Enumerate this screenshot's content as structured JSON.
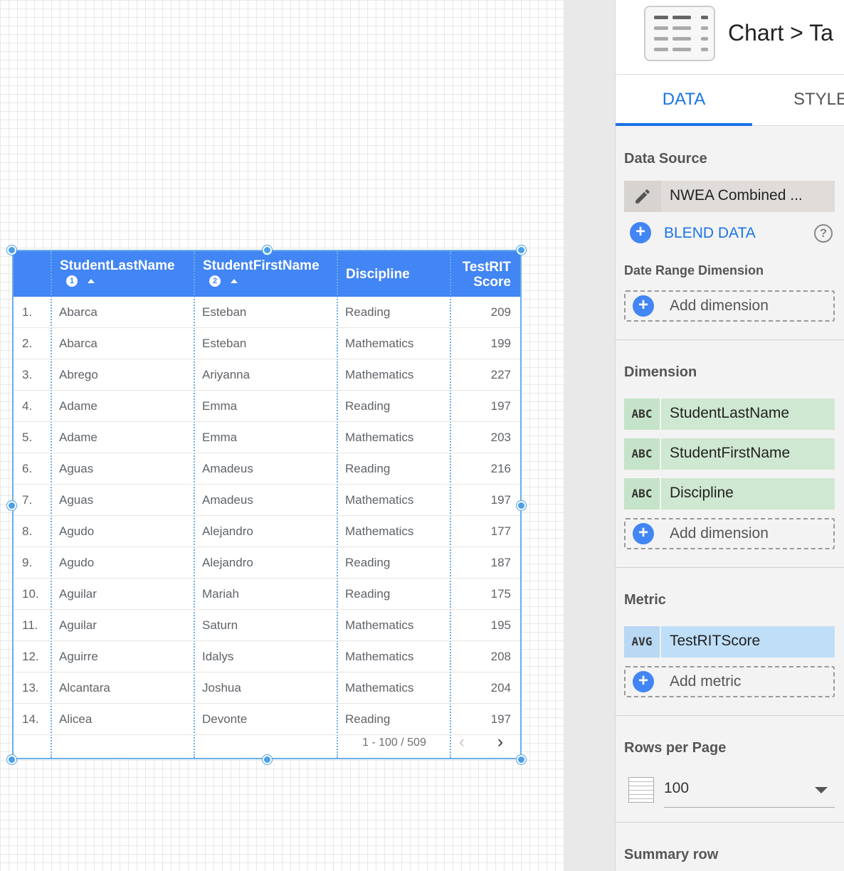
{
  "table": {
    "headers": {
      "last": "StudentLastName",
      "first": "StudentFirstName",
      "discipline": "Discipline",
      "score_line1": "TestRIT",
      "score_line2": "Score",
      "sort1": "1",
      "sort2": "2"
    },
    "rows": [
      [
        "1.",
        "Abarca",
        "Esteban",
        "Reading",
        "209"
      ],
      [
        "2.",
        "Abarca",
        "Esteban",
        "Mathematics",
        "199"
      ],
      [
        "3.",
        "Abrego",
        "Ariyanna",
        "Mathematics",
        "227"
      ],
      [
        "4.",
        "Adame",
        "Emma",
        "Reading",
        "197"
      ],
      [
        "5.",
        "Adame",
        "Emma",
        "Mathematics",
        "203"
      ],
      [
        "6.",
        "Aguas",
        "Amadeus",
        "Reading",
        "216"
      ],
      [
        "7.",
        "Aguas",
        "Amadeus",
        "Mathematics",
        "197"
      ],
      [
        "8.",
        "Agudo",
        "Alejandro",
        "Mathematics",
        "177"
      ],
      [
        "9.",
        "Agudo",
        "Alejandro",
        "Reading",
        "187"
      ],
      [
        "10.",
        "Aguilar",
        "Mariah",
        "Reading",
        "175"
      ],
      [
        "11.",
        "Aguilar",
        "Saturn",
        "Mathematics",
        "195"
      ],
      [
        "12.",
        "Aguirre",
        "Idalys",
        "Mathematics",
        "208"
      ],
      [
        "13.",
        "Alcantara",
        "Joshua",
        "Mathematics",
        "204"
      ],
      [
        "14.",
        "Alicea",
        "Devonte",
        "Reading",
        "197"
      ]
    ],
    "pagination": "1 - 100 / 509",
    "prev_icon": "‹",
    "next_icon": "›"
  },
  "panel": {
    "breadcrumb": "Chart  >  Ta",
    "tabs": {
      "data": "DATA",
      "style": "STYLE"
    },
    "data_source": {
      "title": "Data Source",
      "name": "NWEA Combined ...",
      "blend": "BLEND DATA",
      "help": "?"
    },
    "date_range": {
      "title": "Date Range Dimension",
      "add": "Add dimension"
    },
    "dimension": {
      "title": "Dimension",
      "items": [
        {
          "type": "ABC",
          "name": "StudentLastName"
        },
        {
          "type": "ABC",
          "name": "StudentFirstName"
        },
        {
          "type": "ABC",
          "name": "Discipline"
        }
      ],
      "add": "Add dimension"
    },
    "metric": {
      "title": "Metric",
      "items": [
        {
          "type": "AVG",
          "name": "TestRITScore"
        }
      ],
      "add": "Add metric"
    },
    "rows_per_page": {
      "title": "Rows per Page",
      "value": "100"
    },
    "summary_row": {
      "title": "Summary row"
    }
  },
  "colors": {
    "header_blue": "#4285f4",
    "accent": "#1a73e8",
    "dimension_chip": "#cfe8d1",
    "metric_chip": "#bfdff8"
  }
}
